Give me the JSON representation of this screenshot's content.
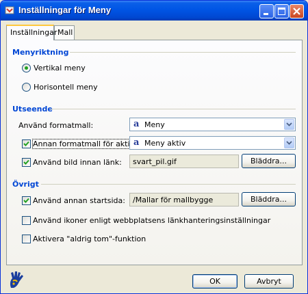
{
  "window": {
    "title": "Inställningar för Meny"
  },
  "tabs": [
    {
      "label": "Inställningar",
      "active": true
    },
    {
      "label": "Mall",
      "active": false
    }
  ],
  "direction": {
    "heading": "Menyriktning",
    "vertical_label": "Vertikal meny",
    "horizontal_label": "Horisontell meny",
    "selected": "vertical"
  },
  "appearance": {
    "heading": "Utseende",
    "stylesheet_label": "Använd formatmall:",
    "stylesheet_value": "Meny",
    "active_style_label": "Annan formatmall för aktiv:",
    "active_style_checked": true,
    "active_style_value": "Meny aktiv",
    "image_label": "Använd bild innan länk:",
    "image_checked": true,
    "image_value": "svart_pil.gif",
    "browse_label": "Bläddra..."
  },
  "other": {
    "heading": "Övrigt",
    "startpage_label": "Använd annan startsida:",
    "startpage_checked": true,
    "startpage_value": "/Mallar för mallbygge",
    "browse_label": "Bläddra...",
    "icons_label": "Använd ikoner enligt webbplatsens länkhanteringsinställningar",
    "icons_checked": false,
    "never_empty_label": "Aktivera \"aldrig tom\"-funktion",
    "never_empty_checked": false
  },
  "footer": {
    "ok_label": "OK",
    "cancel_label": "Avbryt"
  },
  "colors": {
    "title_bar": "#0055e5",
    "group_heading": "#0046d5",
    "check_mark": "#21a121"
  },
  "icons": {
    "title": "app-icon",
    "stylesheet": "stylesheet-ai-icon",
    "logo": "hand-logo-icon"
  }
}
